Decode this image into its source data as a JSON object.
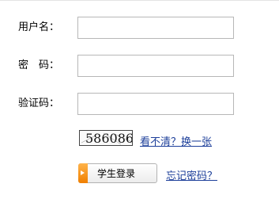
{
  "form": {
    "username_label": "用户名：",
    "password_label": "密　码：",
    "captcha_label": "验证码：",
    "username_value": "",
    "password_value": "",
    "captcha_value": ""
  },
  "captcha": {
    "image_text": "586086",
    "refresh_link": "看不清？换一张"
  },
  "actions": {
    "login_button": "学生登录",
    "forgot_password_link": "忘记密码？"
  },
  "colors": {
    "link": "#1d3f9a",
    "button_accent": "#f08a00",
    "field_border": "#b7b7b7"
  }
}
